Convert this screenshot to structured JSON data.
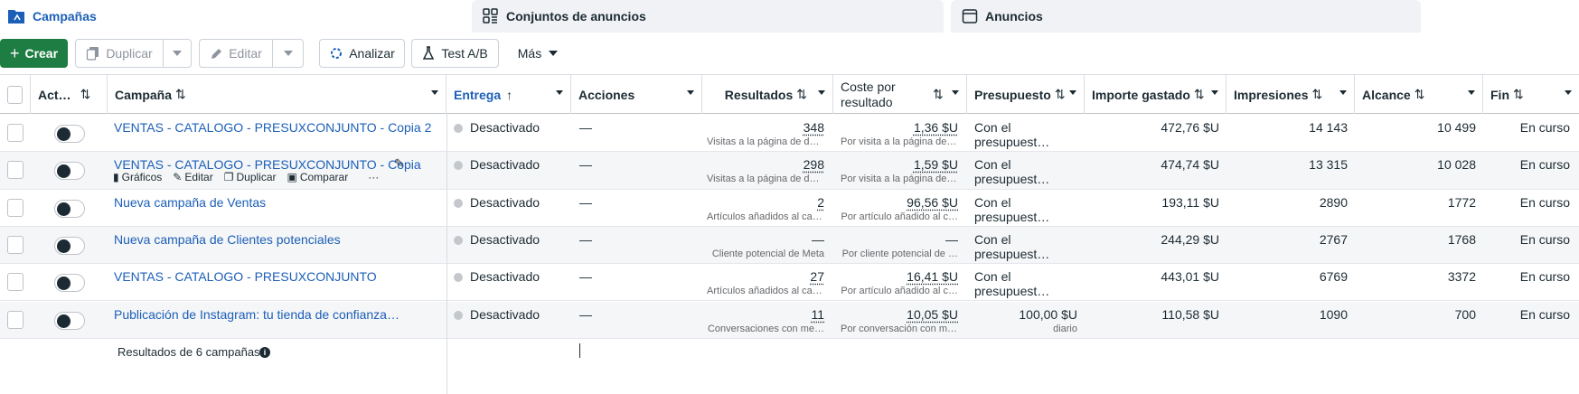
{
  "tabs": {
    "campaigns": "Campañas",
    "adsets": "Conjuntos de anuncios",
    "ads": "Anuncios"
  },
  "toolbar": {
    "create": "Crear",
    "duplicate": "Duplicar",
    "edit": "Editar",
    "analyze": "Analizar",
    "abtest": "Test A/B",
    "more": "Más"
  },
  "columns": {
    "active": "Act…",
    "campaign": "Campaña",
    "delivery": "Entrega",
    "actions": "Acciones",
    "results": "Resultados",
    "cost": "Coste por resultado",
    "budget": "Presupuesto",
    "spent": "Importe gastado",
    "impressions": "Impresiones",
    "reach": "Alcance",
    "end": "Fin"
  },
  "rows": [
    {
      "name": "VENTAS - CATALOGO - PRESUXCONJUNTO - Copia 2",
      "delivery": "Desactivado",
      "actions": "—",
      "results": "348",
      "results_sub": "Visitas a la página de de…",
      "cost": "1,36 $U",
      "cost_sub": "Por visita a la página de …",
      "budget": "Con el presupuest…",
      "budget_sub": "",
      "spent": "472,76 $U",
      "impressions": "14 143",
      "reach": "10 499",
      "end": "En curso"
    },
    {
      "name": "VENTAS - CATALOGO - PRESUXCONJUNTO - Copia",
      "delivery": "Desactivado",
      "actions": "—",
      "results": "298",
      "results_sub": "Visitas a la página de de…",
      "cost": "1,59 $U",
      "cost_sub": "Por visita a la página de …",
      "budget": "Con el presupuest…",
      "budget_sub": "",
      "spent": "474,74 $U",
      "impressions": "13 315",
      "reach": "10 028",
      "end": "En curso"
    },
    {
      "name": "Nueva campaña de Ventas",
      "delivery": "Desactivado",
      "actions": "—",
      "results": "2",
      "results_sub": "Artículos añadidos al car…",
      "cost": "96,56 $U",
      "cost_sub": "Por artículo añadido al c…",
      "budget": "Con el presupuest…",
      "budget_sub": "",
      "spent": "193,11 $U",
      "impressions": "2890",
      "reach": "1772",
      "end": "En curso"
    },
    {
      "name": "Nueva campaña de Clientes potenciales",
      "delivery": "Desactivado",
      "actions": "—",
      "results": "—",
      "results_sub": "Cliente potencial de Meta",
      "cost": "—",
      "cost_sub": "Por cliente potencial de …",
      "budget": "Con el presupuest…",
      "budget_sub": "",
      "spent": "244,29 $U",
      "impressions": "2767",
      "reach": "1768",
      "end": "En curso"
    },
    {
      "name": "VENTAS - CATALOGO - PRESUXCONJUNTO",
      "delivery": "Desactivado",
      "actions": "—",
      "results": "27",
      "results_sub": "Artículos añadidos al car…",
      "cost": "16,41 $U",
      "cost_sub": "Por artículo añadido al c…",
      "budget": "Con el presupuest…",
      "budget_sub": "",
      "spent": "443,01 $U",
      "impressions": "6769",
      "reach": "3372",
      "end": "En curso"
    },
    {
      "name": "Publicación de Instagram: tu tienda de confianza…",
      "delivery": "Desactivado",
      "actions": "—",
      "results": "11",
      "results_sub": "Conversaciones con me…",
      "cost": "10,05 $U",
      "cost_sub": "Por conversación con me…",
      "budget": "100,00 $U",
      "budget_sub": "diario",
      "spent": "110,58 $U",
      "impressions": "1090",
      "reach": "700",
      "end": "En curso"
    }
  ],
  "row_actions": {
    "charts": "Gráficos",
    "edit": "Editar",
    "duplicate": "Duplicar",
    "compare": "Comparar",
    "more": "···"
  },
  "footer": {
    "summary": "Resultados de 6 campañas"
  },
  "colors": {
    "accent": "#1c5fb8",
    "create_green": "#1e7d43"
  }
}
